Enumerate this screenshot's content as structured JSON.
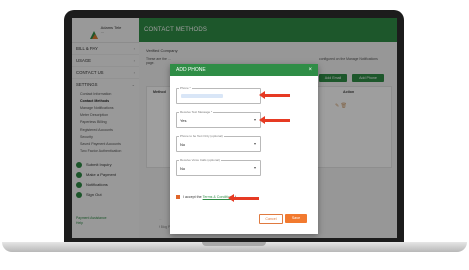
{
  "app": {
    "logo_line1": "Adams Tele",
    "logo_line2": "...",
    "header_title": "CONTACT METHODS"
  },
  "sidebar": {
    "sections": [
      {
        "label": "BILL & PAY",
        "chev": "›"
      },
      {
        "label": "USAGE",
        "chev": "›"
      },
      {
        "label": "CONTACT US",
        "chev": "›"
      },
      {
        "label": "SETTINGS",
        "chev": "⌄"
      }
    ],
    "settings_items": [
      "Contact Information",
      "Contact Methods",
      "Manage Notifications",
      "Meter Description",
      "Paperless Billing",
      "Registered Accounts",
      "Security",
      "Saved Payment Accounts",
      "Two Factor Authentication"
    ],
    "links": [
      "Submit Inquiry",
      "Make a Payment",
      "Notifications",
      "Sign Out"
    ],
    "footer": [
      "Payment Assistance",
      "Help"
    ]
  },
  "main": {
    "company": "Verified Company",
    "info_text": "These are the ...",
    "info_text_right": "configured on the Manage Notifications",
    "info_page": "page.",
    "add_email_label": "Add Email",
    "add_phone_label": "Add Phone",
    "col_method": "Method",
    "col_action": "Action",
    "footer_text": "...",
    "footer_links": "f  Blog Page  Google Play"
  },
  "modal": {
    "title": "ADD PHONE",
    "close_glyph": "×",
    "phone_label": "Phone *",
    "receive_text_label": "Receive Text Message *",
    "receive_text_value": "Yes",
    "text_only_label": "Phone to be Text Only (optional)",
    "text_only_value": "No",
    "voice_calls_label": "Receive Voice Calls (optional)",
    "voice_calls_value": "No",
    "accept_prefix": "I accept the",
    "accept_link": "Terms & Conditions",
    "accept_suffix": "*",
    "cancel_label": "Cancel",
    "save_label": "Save"
  }
}
